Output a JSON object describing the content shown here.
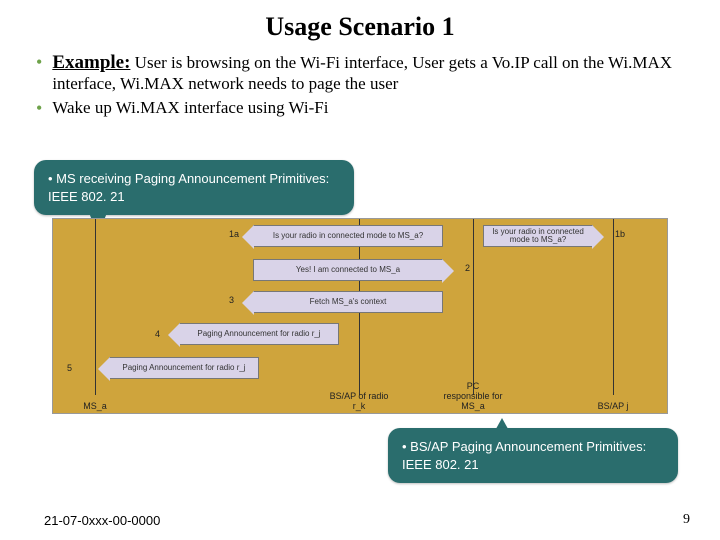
{
  "title": "Usage Scenario 1",
  "bullets": {
    "example_label": "Example:",
    "example_text": " User is browsing on the Wi-Fi interface, User gets a Vo.IP call on the Wi.MAX interface, Wi.MAX network needs to page the user",
    "b2": "Wake up Wi.MAX interface using Wi-Fi"
  },
  "callouts": {
    "top": "• MS receiving Paging Announcement Primitives: IEEE 802. 21",
    "bottom": "• BS/AP Paging Announcement Primitives: IEEE 802. 21"
  },
  "diagram": {
    "nodes": {
      "n1": "MS_a",
      "n2": "BS/AP of radio r_k",
      "n3": "PC responsible for MS_a",
      "n4": "BS/AP j"
    },
    "arrows": {
      "a1a": "Is your radio in connected mode to MS_a?",
      "a1b": "Is your radio in connected mode to MS_a?",
      "a2": "Yes! I am connected to MS_a",
      "a3": "Fetch MS_a's context",
      "a4": "Paging Announcement for radio r_j",
      "a5": "Paging Announcement for radio r_j"
    },
    "nums": {
      "s1a": "1a",
      "s1b": "1b",
      "s2": "2",
      "s3": "3",
      "s4": "4",
      "s5": "5"
    }
  },
  "footer": {
    "left": "21-07-0xxx-00-0000",
    "right": "9"
  }
}
